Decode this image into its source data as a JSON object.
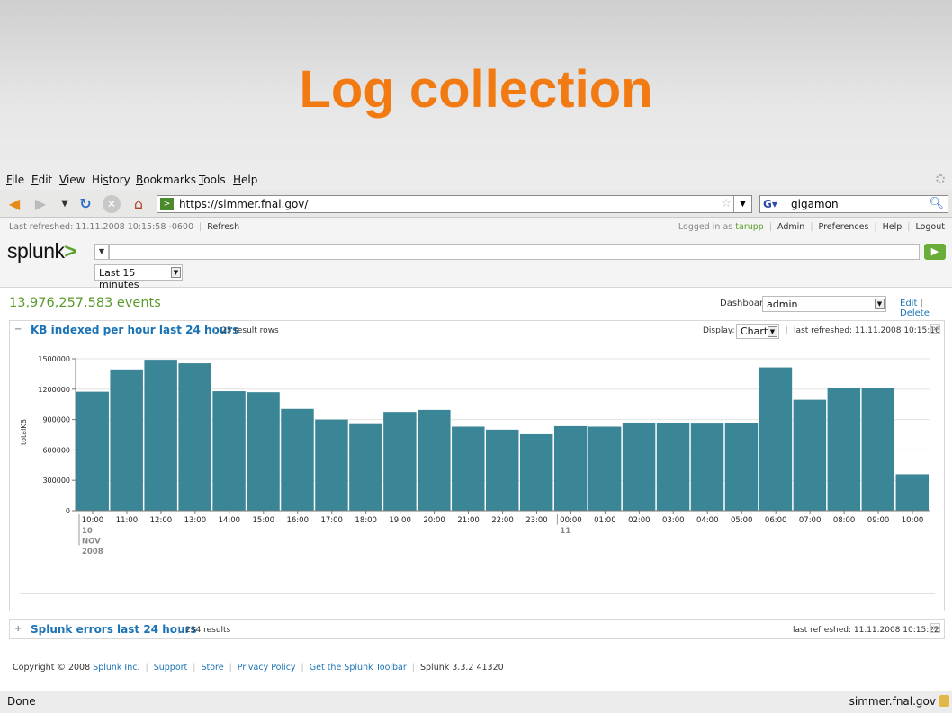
{
  "slide": {
    "title": "Log collection"
  },
  "browser": {
    "menu": [
      {
        "key": "F",
        "rest": "ile"
      },
      {
        "key": "E",
        "rest": "dit"
      },
      {
        "key": "V",
        "rest": "iew"
      },
      {
        "pre": "Hi",
        "key": "s",
        "rest": "tory"
      },
      {
        "key": "B",
        "rest": "ookmarks"
      },
      {
        "key": "T",
        "rest": "ools"
      },
      {
        "key": "H",
        "rest": "elp"
      }
    ],
    "url": "https://simmer.fnal.gov/",
    "search_value": "gigamon",
    "status_left": "Done",
    "status_right": "simmer.fnal.gov"
  },
  "splunk": {
    "last_refreshed": "Last refreshed: 11.11.2008 10:15:58 -0600",
    "refresh": "Refresh",
    "logged_in_as": "Logged in as",
    "user": "tarupp",
    "links": [
      "Admin",
      "Preferences",
      "Help",
      "Logout"
    ],
    "logo": "splunk",
    "logo_mark": ">",
    "time_range": "Last 15 minutes",
    "events": "13,976,257,583 events",
    "dashboard_label": "Dashboard",
    "dashboard_value": "admin",
    "edit": "Edit",
    "delete": "Delete"
  },
  "panel1": {
    "toggle": "−",
    "title": "KB indexed per hour last 24 hours",
    "subtitle": "25 result rows",
    "display_label": "Display:",
    "display_value": "Chart",
    "last_refreshed": "last refreshed: 11.11.2008 10:15:16"
  },
  "panel2": {
    "toggle": "+",
    "title": "Splunk errors last 24 hours",
    "subtitle": "234 results",
    "last_refreshed": "last refreshed: 11.11.2008 10:15:22"
  },
  "footer": {
    "copyright": "Copyright © 2008",
    "company": "Splunk Inc.",
    "links": [
      "Support",
      "Store",
      "Privacy Policy",
      "Get the Splunk Toolbar"
    ],
    "version": "Splunk 3.3.2 41320"
  },
  "colors": {
    "bar": "#3a8596",
    "accent": "#1a73b5",
    "title": "#f27a12"
  },
  "chart_data": {
    "type": "bar",
    "ylabel": "totalKB",
    "ylim": [
      0,
      1500000
    ],
    "yticks": [
      0,
      300000,
      600000,
      900000,
      1200000,
      1500000
    ],
    "categories": [
      "10:00",
      "11:00",
      "12:00",
      "13:00",
      "14:00",
      "15:00",
      "16:00",
      "17:00",
      "18:00",
      "19:00",
      "20:00",
      "21:00",
      "22:00",
      "23:00",
      "00:00",
      "01:00",
      "02:00",
      "03:00",
      "04:00",
      "05:00",
      "06:00",
      "07:00",
      "08:00",
      "09:00",
      "10:00"
    ],
    "values": [
      1175000,
      1395000,
      1490000,
      1455000,
      1180000,
      1170000,
      1005000,
      900000,
      855000,
      975000,
      995000,
      830000,
      800000,
      755000,
      835000,
      830000,
      870000,
      865000,
      860000,
      865000,
      1415000,
      1095000,
      1215000,
      1215000,
      360000
    ],
    "date_labels": [
      {
        "at": 0,
        "lines": [
          "10",
          "NOV",
          "2008"
        ]
      },
      {
        "at": 14,
        "lines": [
          "11"
        ]
      }
    ]
  }
}
